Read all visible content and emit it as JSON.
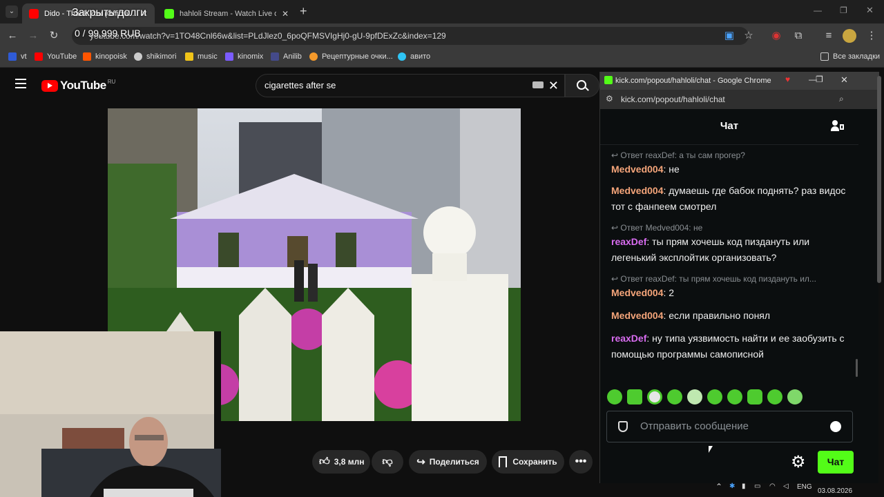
{
  "browser": {
    "tabs": [
      {
        "label": "Dido - Thank You (Official ..."
      },
      {
        "label": "hahloli Stream - Watch Live on ..."
      }
    ],
    "new_tab": "+",
    "url": "youtube.com/watch?v=1TO48Cnl66w&list=PLdJlez0_6poQFMSVIgHj0-gU-9pfDExZc&index=129",
    "bookmarks": [
      {
        "label": "vt",
        "icon": "vt-icon",
        "color": "#2f5bd6"
      },
      {
        "label": "YouTube",
        "icon": "youtube-icon",
        "color": "#ff0000"
      },
      {
        "label": "kinopoisk",
        "icon": "kinopoisk-icon",
        "color": "#ff5500"
      },
      {
        "label": "shikimori",
        "icon": "shikimori-icon",
        "color": "#cccccc"
      },
      {
        "label": "music",
        "icon": "music-icon",
        "color": "#f0c419"
      },
      {
        "label": "kinomix",
        "icon": "kinomix-icon",
        "color": "#7b5cff"
      },
      {
        "label": "Anilib",
        "icon": "anilib-icon",
        "color": "#444a8a"
      },
      {
        "label": "Рецептурные очки...",
        "icon": "glasses-icon",
        "color": "#f59a2b"
      },
      {
        "label": "авито",
        "icon": "avito-icon",
        "color": "#2fc5f5"
      }
    ],
    "all_bookmarks": "Все закладки"
  },
  "overlay": {
    "line1": "Закрыть долги",
    "line2": "0 / 99,999 RUB"
  },
  "youtube": {
    "logo": "YouTube",
    "region": "RU",
    "search_value": "cigarettes after se",
    "likes": "3,8 млн",
    "share": "Поделиться",
    "save": "Сохранить"
  },
  "kick": {
    "window_title": "kick.com/popout/hahloli/chat - Google Chrome",
    "url": "kick.com/popout/hahloli/chat",
    "chat_title": "Чат",
    "messages": [
      {
        "reply": "Ответ reaxDef: а ты сам прогер?",
        "user": "Medved004",
        "text": ": не",
        "cls": "u-medved"
      },
      {
        "reply": "",
        "user": "Medved004",
        "text": ": думаешь где бабок поднять? раз видос тот с фанпеем смотрел",
        "cls": "u-medved"
      },
      {
        "reply": "Ответ Medved004: не",
        "user": "reaxDef",
        "text": ": ты прям хочешь код пиздануть или легенький эксплойтик организовать?",
        "cls": "u-reax"
      },
      {
        "reply": "Ответ reaxDef: ты прям хочешь код пиздануть ил...",
        "user": "Medved004",
        "text": ": 2",
        "cls": "u-medved"
      },
      {
        "reply": "",
        "user": "Medved004",
        "text": ": если правильно понял",
        "cls": "u-medved"
      },
      {
        "reply": "",
        "user": "reaxDef",
        "text": ": ну типа уязвимость найти и ее заобузить с помощью программы самописной",
        "cls": "u-reax"
      }
    ],
    "input_placeholder": "Отправить сообщение",
    "send_button": "Чат"
  },
  "taskbar": {
    "lang": "ENG",
    "date": "03.08.2026"
  }
}
